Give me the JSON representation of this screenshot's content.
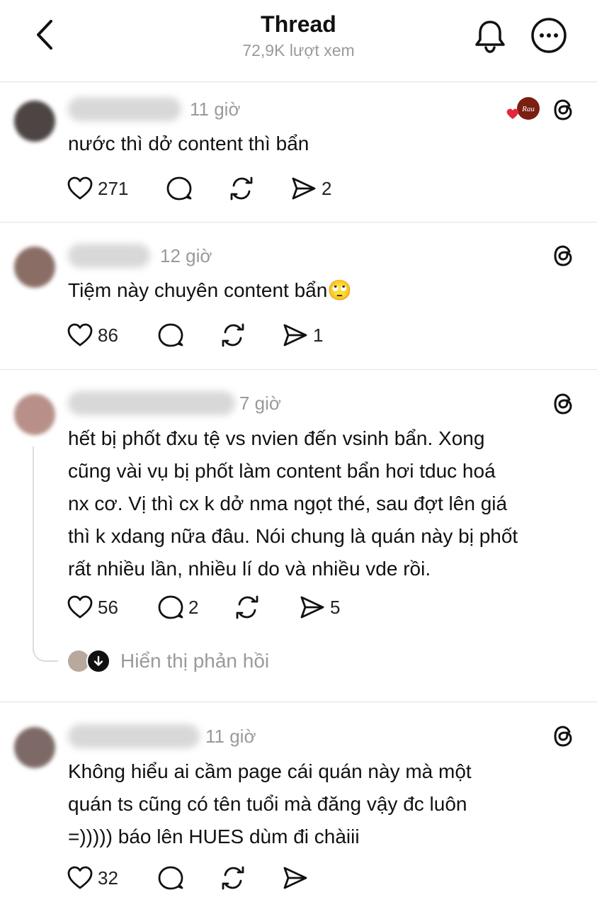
{
  "header": {
    "title": "Thread",
    "subtitle": "72,9K lượt xem"
  },
  "comments": [
    {
      "time": "11 giờ",
      "text": "nước thì dở content thì bẩn",
      "likes": "271",
      "replies": "",
      "reposts": "",
      "shares": "2",
      "avatar_color": "#5a5250"
    },
    {
      "time": "12 giờ",
      "text": "Tiệm này chuyên content bẩn🙄",
      "likes": "86",
      "replies": "",
      "reposts": "",
      "shares": "1",
      "avatar_color": "#8a6e66"
    },
    {
      "time": "7 giờ",
      "text": "hết bị phốt đxu tệ vs nvien đến vsinh bẩn. Xong\ncũng vài vụ bị phốt làm content bẩn hơi tduc hoá\nnx cơ. Vị thì cx k dở nma ngọt thé, sau đợt lên giá\nthì k xdang nữa đâu. Nói chung là quán này bị phốt\nrất nhiều lần, nhiều lí do và nhiều vde rồi.",
      "likes": "56",
      "replies": "2",
      "reposts": "",
      "shares": "5",
      "avatar_color": "#b89089",
      "show_replies_label": "Hiển thị phản hồi"
    },
    {
      "time": "11 giờ",
      "text": "Không hiểu ai cầm page cái quán này mà một\nquán ts cũng có tên tuổi mà đăng vậy đc luôn\n=))))) báo lên HUES dùm đi chàiii",
      "likes": "32",
      "replies": "",
      "reposts": "",
      "shares": "",
      "avatar_color": "#7d6a66"
    }
  ],
  "liked_badge": {
    "label": "Rau",
    "heart_color": "#e5283b",
    "badge_color": "#7a1f12"
  }
}
